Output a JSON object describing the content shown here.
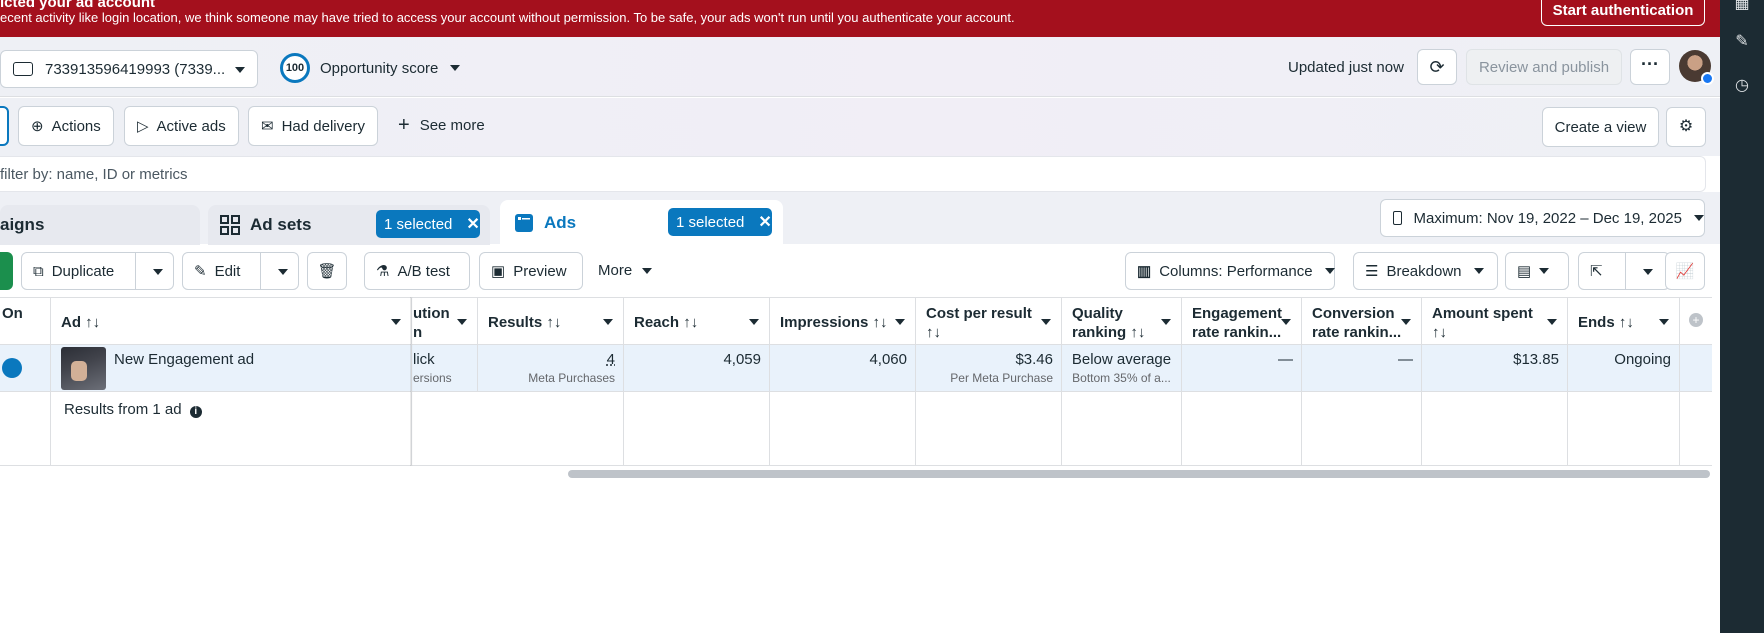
{
  "banner": {
    "title": "icted your ad account",
    "message": "ecent activity like login location, we think someone may have tried to access your account without permission. To be safe, your ads won't run until you authenticate your account.",
    "button": "Start authentication"
  },
  "topbar": {
    "account": "733913596419993 (7339...",
    "opportunity_value": "100",
    "opportunity_label": "Opportunity score",
    "updated": "Updated just now",
    "review_publish": "Review and publish"
  },
  "chips": {
    "actions": "Actions",
    "active_ads": "Active ads",
    "had_delivery": "Had delivery",
    "see_more": "See more",
    "create_view": "Create a view"
  },
  "search": {
    "placeholder": "filter by: name, ID or metrics"
  },
  "tabs": {
    "campaigns": "aigns",
    "adsets": "Ad sets",
    "adsets_selected": "1 selected",
    "ads": "Ads",
    "ads_selected": "1 selected",
    "date_range": "Maximum: Nov 19, 2022 – Dec 19, 2025"
  },
  "toolbar": {
    "duplicate": "Duplicate",
    "edit": "Edit",
    "ab_test": "A/B test",
    "preview": "Preview",
    "more": "More",
    "columns": "Columns: Performance",
    "breakdown": "Breakdown"
  },
  "table": {
    "headers": {
      "on": "On",
      "ad": "Ad ↑↓",
      "attribution_1": "ution",
      "attribution_2": "n",
      "results": "Results ↑↓",
      "reach": "Reach ↑↓",
      "impressions": "Impressions ↑↓",
      "cpr_1": "Cost per result",
      "cpr_2": "↑↓",
      "quality_1": "Quality",
      "quality_2": "ranking ↑↓",
      "engagement_1": "Engagement",
      "engagement_2": "rate rankin...",
      "conversion_1": "Conversion",
      "conversion_2": "rate rankin...",
      "spent_1": "Amount spent",
      "spent_2": "↑↓",
      "ends": "Ends ↑↓"
    },
    "row": {
      "ad_name": "New Engagement ad",
      "attribution": "lick",
      "attribution_sub": "ersions",
      "results": "4",
      "results_sub": "Meta Purchases",
      "reach": "4,059",
      "impressions": "4,060",
      "cpr": "$3.46",
      "cpr_sub": "Per Meta Purchase",
      "quality": "Below average",
      "quality_sub": "Bottom 35% of a...",
      "engagement": "—",
      "conversion": "—",
      "spent": "$13.85",
      "ends": "Ongoing"
    },
    "summary": "Results from 1 ad"
  }
}
